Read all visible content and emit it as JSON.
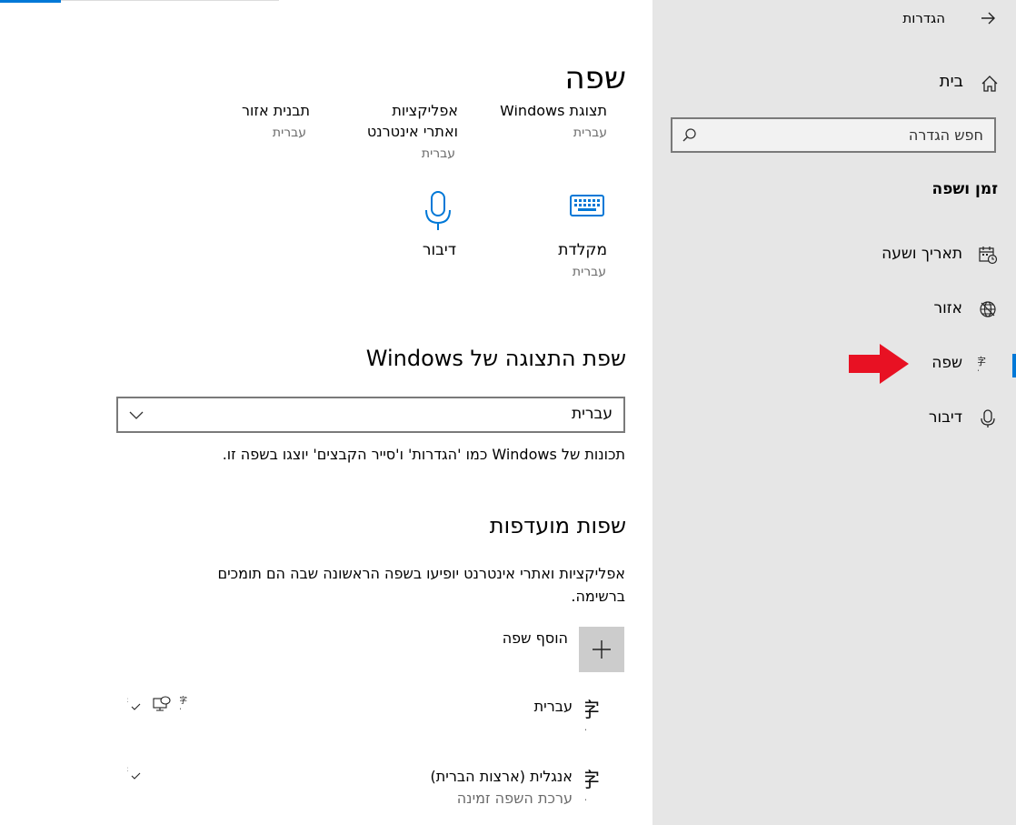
{
  "sidebar": {
    "settings_title": "הגדרות",
    "home_label": "בית",
    "search_placeholder": "חפש הגדרה",
    "section_title": "זמן ושפה",
    "items": [
      {
        "label": "תאריך ושעה",
        "icon": "calendar-clock-icon"
      },
      {
        "label": "אזור",
        "icon": "globe-icon"
      },
      {
        "label": "שפה",
        "icon": "language-icon",
        "active": true
      },
      {
        "label": "דיבור",
        "icon": "microphone-icon"
      }
    ]
  },
  "main": {
    "title": "שפה",
    "top_tiles": [
      {
        "label": "תצוגת Windows",
        "sub": "עברית"
      },
      {
        "label_lines": [
          "אפליקציות",
          "ואתרי אינטרנט"
        ],
        "sub": "עברית"
      },
      {
        "label": "תבנית אזור",
        "sub": "עברית"
      }
    ],
    "tiles": [
      {
        "label": "מקלדת",
        "sub": "עברית",
        "icon": "keyboard-icon"
      },
      {
        "label": "דיבור",
        "icon": "microphone-icon"
      }
    ],
    "display_language": {
      "heading": "שפת התצוגה של Windows",
      "selected": "עברית",
      "description": "תכונות של Windows כמו 'הגדרות' ו'סייר הקבצים' יוצגו בשפה זו."
    },
    "preferred": {
      "heading": "שפות מועדפות",
      "description_line1": "אפליקציות ואתרי אינטרנט יופיעו בשפה הראשונה שבה הם תומכים",
      "description_line2": "ברשימה.",
      "add_label": "הוסף שפה",
      "languages": [
        {
          "name": "עברית",
          "sub": ""
        },
        {
          "name": "אנגלית (ארצות הברית)",
          "sub": "ערכת השפה זמינה"
        }
      ]
    }
  },
  "annotation": {
    "arrow_color": "#e81123"
  },
  "colors": {
    "accent": "#0078d7",
    "sidebar_bg": "#e6e6e6"
  }
}
